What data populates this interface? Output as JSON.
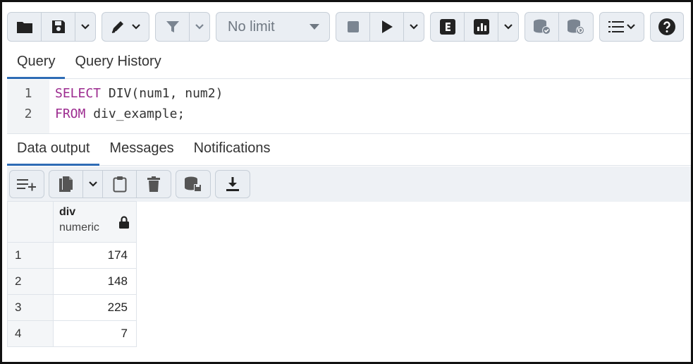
{
  "toolbar": {
    "limit_select": "No limit"
  },
  "query_tabs": [
    {
      "label": "Query",
      "active": true
    },
    {
      "label": "Query History",
      "active": false
    }
  ],
  "editor": {
    "line_numbers": [
      "1",
      "2"
    ],
    "line1": {
      "keyword": "SELECT",
      "rest": " DIV(num1, num2)"
    },
    "line2": {
      "keyword": "FROM",
      "rest": " div_example;"
    }
  },
  "output_tabs": [
    {
      "label": "Data output",
      "active": true
    },
    {
      "label": "Messages",
      "active": false
    },
    {
      "label": "Notifications",
      "active": false
    }
  ],
  "grid": {
    "column": {
      "name": "div",
      "type": "numeric"
    },
    "rows": [
      {
        "num": "1",
        "value": "174"
      },
      {
        "num": "2",
        "value": "148"
      },
      {
        "num": "3",
        "value": "225"
      },
      {
        "num": "4",
        "value": "7"
      }
    ]
  },
  "colors": {
    "accent": "#2e6cb5",
    "keyword": "#9c2b8f"
  }
}
